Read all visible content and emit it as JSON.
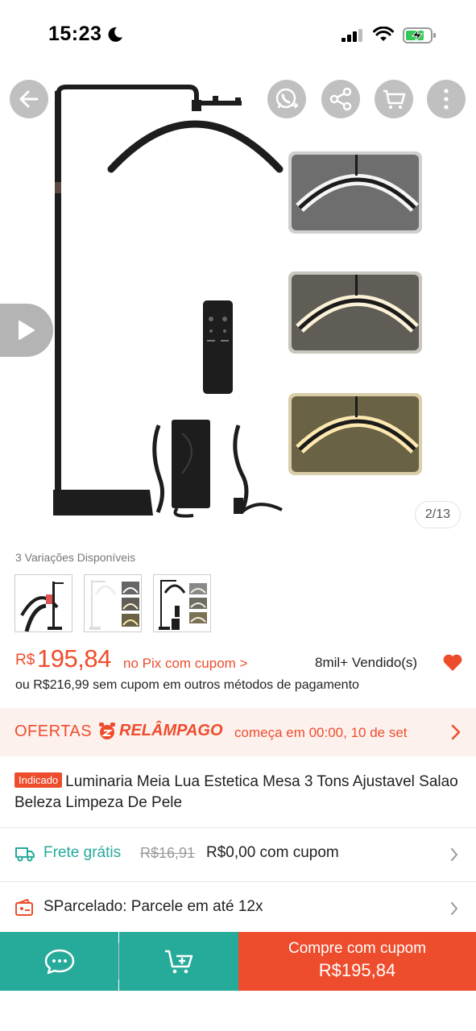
{
  "status_bar": {
    "time": "15:23"
  },
  "gallery": {
    "page_indicator": "2/13",
    "icons": [
      "back-arrow-icon",
      "whatsapp-share-icon",
      "share-icon",
      "cart-icon",
      "more-icon",
      "play-icon"
    ]
  },
  "variations": {
    "label": "3 Variações Disponíveis",
    "count": 3
  },
  "price": {
    "currency": "R$",
    "value": "195,84",
    "pix_note": "no Pix com cupom >",
    "sold": "8mil+ Vendido(s)",
    "alt_price": "ou R$216,99 sem cupom em outros métodos de pagamento"
  },
  "flash_sale": {
    "ofertas": "OFERTAS",
    "relampago": "RELÂMPAGO",
    "starts": "começa em 00:00, 10 de set"
  },
  "product": {
    "badge": "Indicado",
    "title": "Luminaria Meia Lua Estetica Mesa 3 Tons Ajustavel Salao Beleza Limpeza De Pele"
  },
  "shipping": {
    "label": "Frete grátis",
    "old_price": "R$16,91",
    "new_price": "R$0,00 com cupom"
  },
  "installments": {
    "label": "SParcelado: Parcele em até 12x"
  },
  "bottom_bar": {
    "buy_label": "Compre com cupom",
    "buy_price": "R$195,84"
  },
  "colors": {
    "accent": "#ee4d2d",
    "teal": "#26aa99",
    "flash_bg": "#fdf1ee"
  }
}
